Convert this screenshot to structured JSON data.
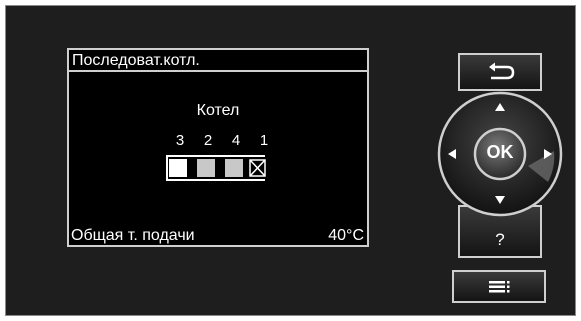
{
  "display": {
    "title": "Последоват.котл.",
    "boiler_label": "Котел",
    "sequence": [
      "3",
      "2",
      "4",
      "1"
    ],
    "boiler_states": [
      "active",
      "standby",
      "standby",
      "disabled"
    ],
    "flow_label": "Общая т. подачи",
    "flow_value": "40°C"
  },
  "controls": {
    "ok_label": "OK",
    "help_label": "?",
    "back_icon": "return-arrow-icon",
    "menu_icon": "menu-list-icon",
    "arrow_icons": [
      "arrow-up-icon",
      "arrow-down-icon",
      "arrow-left-icon",
      "arrow-right-icon"
    ]
  },
  "colors": {
    "bezel": "#1e1e1e",
    "screen_bg": "#000000",
    "screen_text": "#ffffff",
    "boiler_active": "#ffffff",
    "boiler_standby": "#c8c8c8"
  }
}
